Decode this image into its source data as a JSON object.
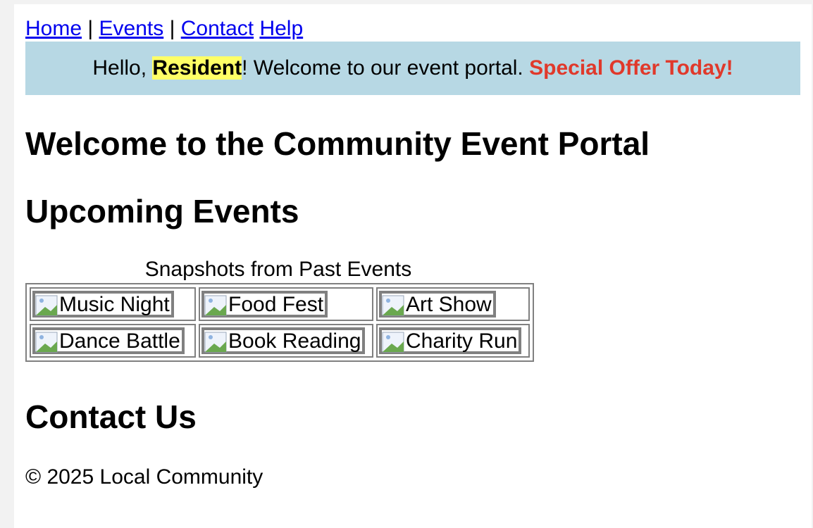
{
  "nav": {
    "items": [
      {
        "label": "Home"
      },
      {
        "label": "Events"
      },
      {
        "label": "Contact"
      },
      {
        "label": "Help"
      }
    ],
    "separator": "|"
  },
  "banner": {
    "greeting": "Hello, ",
    "name": "Resident",
    "message": "! Welcome to our event portal. ",
    "offer": "Special Offer Today!",
    "colors": {
      "background": "#b7d8e4",
      "highlight": "#ffff66",
      "offer": "#e0392b"
    }
  },
  "headings": {
    "portal": "Welcome to the Community Event Portal",
    "upcoming": "Upcoming Events",
    "contact": "Contact Us"
  },
  "gallery": {
    "caption": "Snapshots from Past Events",
    "rows": [
      [
        {
          "alt": "Music Night",
          "icon": "broken-image-icon"
        },
        {
          "alt": "Food Fest",
          "icon": "broken-image-icon"
        },
        {
          "alt": "Art Show",
          "icon": "broken-image-icon"
        }
      ],
      [
        {
          "alt": "Dance Battle",
          "icon": "broken-image-icon"
        },
        {
          "alt": "Book Reading",
          "icon": "broken-image-icon"
        },
        {
          "alt": "Charity Run",
          "icon": "broken-image-icon"
        }
      ]
    ]
  },
  "footer": {
    "text": "© 2025 Local Community"
  }
}
